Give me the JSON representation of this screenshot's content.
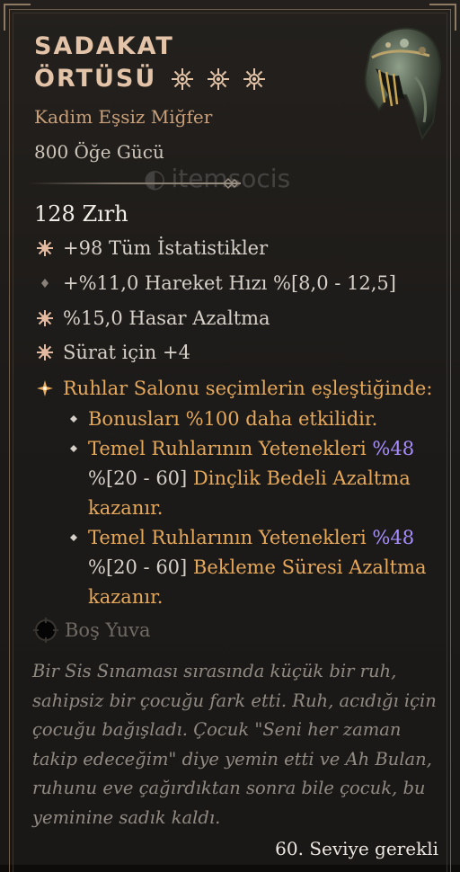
{
  "item": {
    "name_line1": "SADAKAT",
    "name_line2": "ÖRTÜSÜ",
    "type": "Kadim Eşsiz Miğfer",
    "item_power": "800 Öğe Gücü",
    "armor": "128 Zırh",
    "greater_affix_count": 3,
    "colors": {
      "title": "#e4c4a8",
      "type": "#c9a07a",
      "legendary": "#e6a85a",
      "value_highlight": "#a88dff",
      "flavor": "#918a83"
    }
  },
  "stats": [
    {
      "text": "+98 Tüm İstatistikler",
      "icon": "greater-affix-icon"
    },
    {
      "text": "+%11,0 Hareket Hızı %[8,0 - 12,5]",
      "icon": "small-diamond-icon"
    },
    {
      "text": "%15,0 Hasar Azaltma",
      "icon": "greater-affix-icon"
    },
    {
      "text": "Sürat için +4",
      "icon": "greater-affix-icon"
    }
  ],
  "unique_power": {
    "intro": "Ruhlar Salonu seçimlerin eşleştiğinde:",
    "bullets": [
      {
        "text": "Bonusları %100 daha etkilidir."
      },
      {
        "pre": "Temel Ruhlarının Yetenekleri ",
        "value": "%48",
        "range": "%[20 - 60]",
        "post": " Dinçlik Bedeli Azaltma kazanır."
      },
      {
        "pre": "Temel Ruhlarının Yetenekleri ",
        "value": "%48",
        "range": "%[20 - 60]",
        "post": " Bekleme Süresi Azaltma kazanır."
      }
    ]
  },
  "socket": "Boş Yuva",
  "flavor": "Bir Sis Sınaması sırasında küçük bir ruh, sahipsiz bir çocuğu fark etti. Ruh, acıdığı için çocuğu bağışladı. Çocuk \"Seni her zaman takip edeceğim\" diye yemin etti ve Ah Bulan, ruhunu eve çağırdıktan sonra bile çocuk, bu yeminine sadık kaldı.",
  "required_level": "60. Seviye gerekli",
  "watermark": "itemsocis"
}
